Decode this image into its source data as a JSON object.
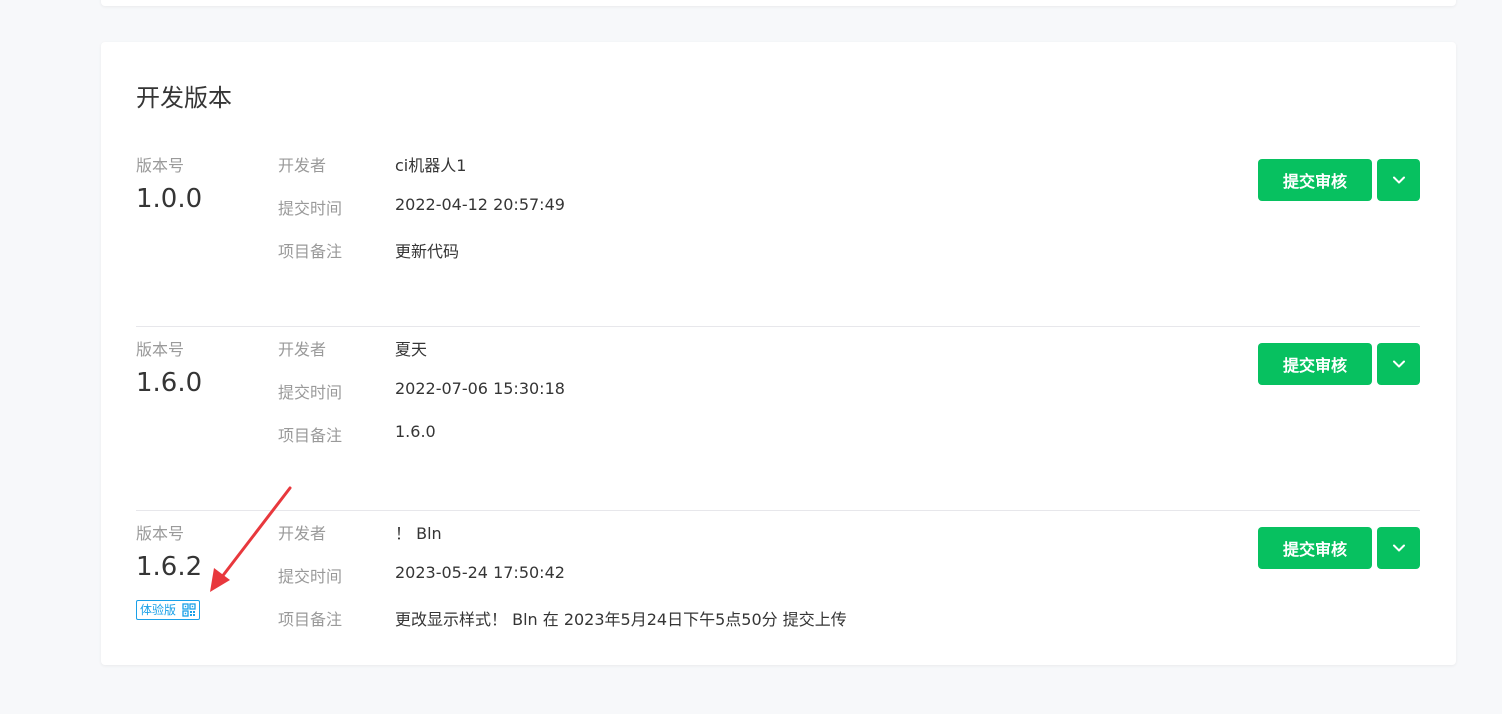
{
  "section_title": "开发版本",
  "versions": [
    {
      "label": "版本号",
      "number": "1.0.0",
      "badge": null,
      "developer_key": "开发者",
      "developer": "ci机器人1",
      "time_key": "提交时间",
      "time": "2022-04-12 20:57:49",
      "note_key": "项目备注",
      "note": "更新代码",
      "submit_label": "提交审核"
    },
    {
      "label": "版本号",
      "number": "1.6.0",
      "badge": null,
      "developer_key": "开发者",
      "developer": "夏天",
      "time_key": "提交时间",
      "time": "2022-07-06 15:30:18",
      "note_key": "项目备注",
      "note": "1.6.0",
      "submit_label": "提交审核"
    },
    {
      "label": "版本号",
      "number": "1.6.2",
      "badge": "体验版",
      "developer_key": "开发者",
      "developer": "！ Bln",
      "time_key": "提交时间",
      "time": "2023-05-24 17:50:42",
      "note_key": "项目备注",
      "note": "更改显示样式！ Bln 在 2023年5月24日下午5点50分 提交上传",
      "submit_label": "提交审核"
    }
  ],
  "colors": {
    "accent": "#07c160",
    "badge": "#1aa0e8",
    "annotation": "#e8383d"
  },
  "icons": {
    "dropdown": "chevron-down-icon",
    "badge": "qr-code-icon"
  }
}
